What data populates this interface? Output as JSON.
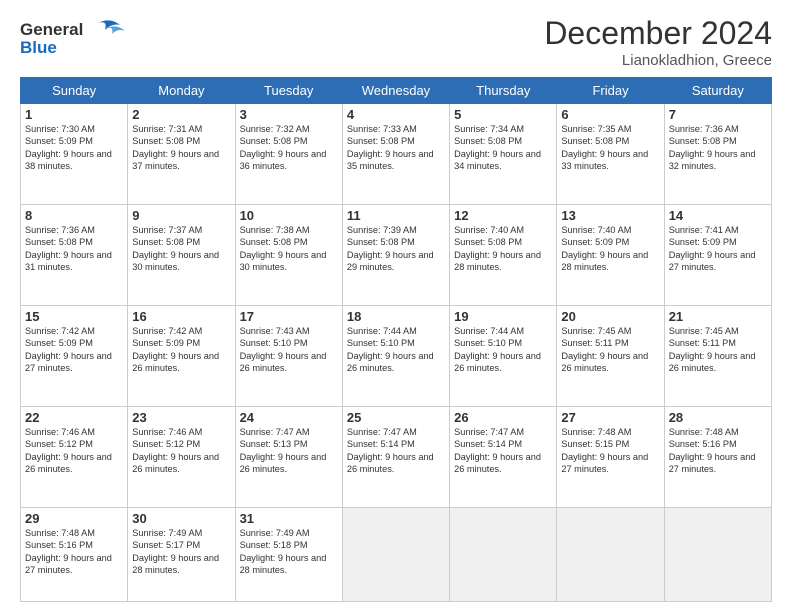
{
  "header": {
    "logo_line1": "General",
    "logo_line2": "Blue",
    "month": "December 2024",
    "location": "Lianokladhion, Greece"
  },
  "weekdays": [
    "Sunday",
    "Monday",
    "Tuesday",
    "Wednesday",
    "Thursday",
    "Friday",
    "Saturday"
  ],
  "weeks": [
    [
      {
        "day": 1,
        "sunrise": "7:30 AM",
        "sunset": "5:09 PM",
        "daylight": "9 hours and 38 minutes."
      },
      {
        "day": 2,
        "sunrise": "7:31 AM",
        "sunset": "5:08 PM",
        "daylight": "9 hours and 37 minutes."
      },
      {
        "day": 3,
        "sunrise": "7:32 AM",
        "sunset": "5:08 PM",
        "daylight": "9 hours and 36 minutes."
      },
      {
        "day": 4,
        "sunrise": "7:33 AM",
        "sunset": "5:08 PM",
        "daylight": "9 hours and 35 minutes."
      },
      {
        "day": 5,
        "sunrise": "7:34 AM",
        "sunset": "5:08 PM",
        "daylight": "9 hours and 34 minutes."
      },
      {
        "day": 6,
        "sunrise": "7:35 AM",
        "sunset": "5:08 PM",
        "daylight": "9 hours and 33 minutes."
      },
      {
        "day": 7,
        "sunrise": "7:36 AM",
        "sunset": "5:08 PM",
        "daylight": "9 hours and 32 minutes."
      }
    ],
    [
      {
        "day": 8,
        "sunrise": "7:36 AM",
        "sunset": "5:08 PM",
        "daylight": "9 hours and 31 minutes."
      },
      {
        "day": 9,
        "sunrise": "7:37 AM",
        "sunset": "5:08 PM",
        "daylight": "9 hours and 30 minutes."
      },
      {
        "day": 10,
        "sunrise": "7:38 AM",
        "sunset": "5:08 PM",
        "daylight": "9 hours and 30 minutes."
      },
      {
        "day": 11,
        "sunrise": "7:39 AM",
        "sunset": "5:08 PM",
        "daylight": "9 hours and 29 minutes."
      },
      {
        "day": 12,
        "sunrise": "7:40 AM",
        "sunset": "5:08 PM",
        "daylight": "9 hours and 28 minutes."
      },
      {
        "day": 13,
        "sunrise": "7:40 AM",
        "sunset": "5:09 PM",
        "daylight": "9 hours and 28 minutes."
      },
      {
        "day": 14,
        "sunrise": "7:41 AM",
        "sunset": "5:09 PM",
        "daylight": "9 hours and 27 minutes."
      }
    ],
    [
      {
        "day": 15,
        "sunrise": "7:42 AM",
        "sunset": "5:09 PM",
        "daylight": "9 hours and 27 minutes."
      },
      {
        "day": 16,
        "sunrise": "7:42 AM",
        "sunset": "5:09 PM",
        "daylight": "9 hours and 26 minutes."
      },
      {
        "day": 17,
        "sunrise": "7:43 AM",
        "sunset": "5:10 PM",
        "daylight": "9 hours and 26 minutes."
      },
      {
        "day": 18,
        "sunrise": "7:44 AM",
        "sunset": "5:10 PM",
        "daylight": "9 hours and 26 minutes."
      },
      {
        "day": 19,
        "sunrise": "7:44 AM",
        "sunset": "5:10 PM",
        "daylight": "9 hours and 26 minutes."
      },
      {
        "day": 20,
        "sunrise": "7:45 AM",
        "sunset": "5:11 PM",
        "daylight": "9 hours and 26 minutes."
      },
      {
        "day": 21,
        "sunrise": "7:45 AM",
        "sunset": "5:11 PM",
        "daylight": "9 hours and 26 minutes."
      }
    ],
    [
      {
        "day": 22,
        "sunrise": "7:46 AM",
        "sunset": "5:12 PM",
        "daylight": "9 hours and 26 minutes."
      },
      {
        "day": 23,
        "sunrise": "7:46 AM",
        "sunset": "5:12 PM",
        "daylight": "9 hours and 26 minutes."
      },
      {
        "day": 24,
        "sunrise": "7:47 AM",
        "sunset": "5:13 PM",
        "daylight": "9 hours and 26 minutes."
      },
      {
        "day": 25,
        "sunrise": "7:47 AM",
        "sunset": "5:14 PM",
        "daylight": "9 hours and 26 minutes."
      },
      {
        "day": 26,
        "sunrise": "7:47 AM",
        "sunset": "5:14 PM",
        "daylight": "9 hours and 26 minutes."
      },
      {
        "day": 27,
        "sunrise": "7:48 AM",
        "sunset": "5:15 PM",
        "daylight": "9 hours and 27 minutes."
      },
      {
        "day": 28,
        "sunrise": "7:48 AM",
        "sunset": "5:16 PM",
        "daylight": "9 hours and 27 minutes."
      }
    ],
    [
      {
        "day": 29,
        "sunrise": "7:48 AM",
        "sunset": "5:16 PM",
        "daylight": "9 hours and 27 minutes."
      },
      {
        "day": 30,
        "sunrise": "7:49 AM",
        "sunset": "5:17 PM",
        "daylight": "9 hours and 28 minutes."
      },
      {
        "day": 31,
        "sunrise": "7:49 AM",
        "sunset": "5:18 PM",
        "daylight": "9 hours and 28 minutes."
      },
      null,
      null,
      null,
      null
    ]
  ]
}
